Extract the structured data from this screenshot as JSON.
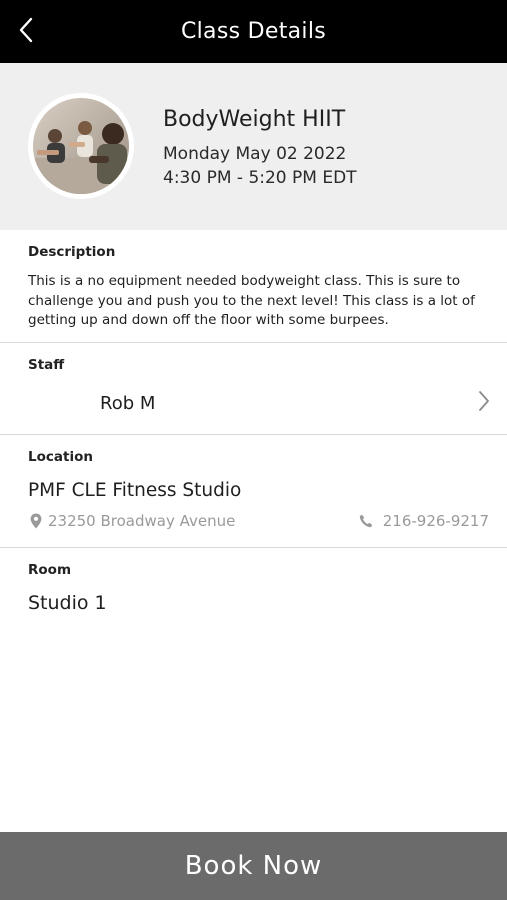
{
  "header": {
    "title": "Class Details"
  },
  "class": {
    "name": "BodyWeight HIIT",
    "date": "Monday May 02 2022",
    "time": "4:30 PM - 5:20 PM EDT"
  },
  "description": {
    "label": "Description",
    "text": "This is a no equipment needed bodyweight class. This is sure to challenge you and push you to the next level! This class is a lot of getting up and down off the floor with some burpees."
  },
  "staff": {
    "label": "Staff",
    "name": "Rob M"
  },
  "location": {
    "label": "Location",
    "name": "PMF CLE Fitness Studio",
    "address": "23250 Broadway Avenue",
    "phone": "216-926-9217"
  },
  "room": {
    "label": "Room",
    "name": "Studio 1"
  },
  "actions": {
    "book_label": "Book Now"
  },
  "colors": {
    "header_bg": "#000000",
    "hero_bg": "#efefef",
    "book_bg": "#6b6b6b",
    "muted_text": "#9a9a9a"
  },
  "icons": [
    "back-chevron-icon",
    "class-photo",
    "chevron-right-icon",
    "map-pin-icon",
    "phone-icon"
  ]
}
